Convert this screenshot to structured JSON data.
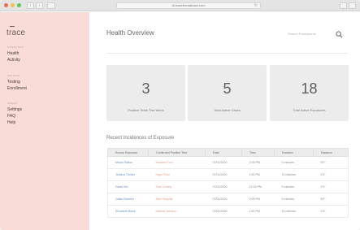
{
  "browser": {
    "url": "dr.tracefromatrace.com",
    "nav_back": "‹",
    "nav_fwd": "›",
    "reload": "↻"
  },
  "sidebar": {
    "logo": "trace",
    "sections": [
      {
        "header": "OVERVIEW",
        "items": [
          "Health",
          "Activity"
        ]
      },
      {
        "header": "MANAGE",
        "items": [
          "Testing",
          "Enrollment"
        ]
      },
      {
        "header": "ADMIN",
        "items": [
          "Settings",
          "FAQ",
          "Help"
        ]
      }
    ]
  },
  "main": {
    "title": "Health Overview",
    "search_placeholder": "Search Participants",
    "cards": [
      {
        "value": "3",
        "label": "Positive Tests This Week"
      },
      {
        "value": "5",
        "label": "Total Active Cases"
      },
      {
        "value": "18",
        "label": "Total Active Exposures"
      }
    ],
    "exposures_title": "Recent Incidences of Exposure",
    "table": {
      "columns": [
        "Known Exposure",
        "Confirmed Positive Test",
        "Date",
        "Time",
        "Duration",
        "Distance"
      ],
      "rows": [
        [
          "Micah Patton",
          "Heather Ford",
          "07/01/2020",
          "2:05 PM",
          "5 minutes",
          "5'0\""
        ],
        [
          "Jessica Timber",
          "Hays Pinto",
          "07/01/2020",
          "1:50 PM",
          "15 minutes",
          "2'4\""
        ],
        [
          "David Wu",
          "Sam Crosby",
          "07/01/2020",
          "12:34 PM",
          "5 minutes",
          "2'0\""
        ],
        [
          "Julian Bahmer",
          "Alex Huaylas",
          "07/01/2020",
          "2:05 PM",
          "5 minutes",
          "5'0\""
        ],
        [
          "Elizabeth Black",
          "Katrina Johnson",
          "07/01/2020",
          "1:52 PM",
          "15 minutes",
          "2'4\""
        ]
      ]
    }
  },
  "colors": {
    "sidebar_bg": "#f9dcd7",
    "exposed_link": "#6b8fc4",
    "positive_link": "#e79a88",
    "card_bg": "#ececec"
  }
}
